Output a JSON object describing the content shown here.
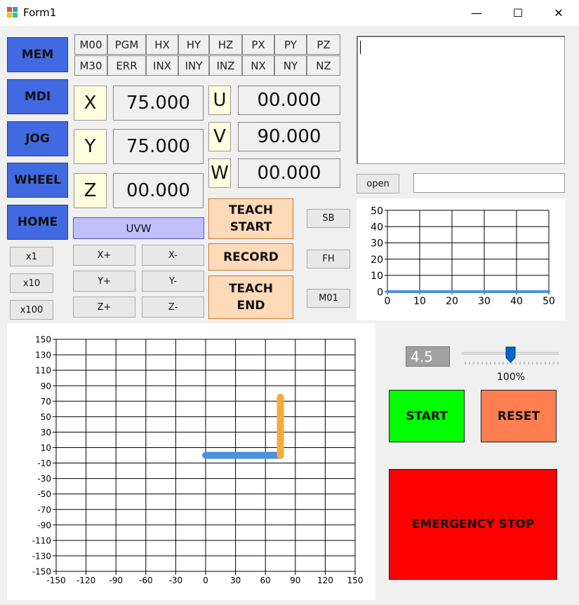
{
  "window": {
    "title": "Form1",
    "minimize": "—",
    "maximize": "☐",
    "close": "✕"
  },
  "modes": [
    "MEM",
    "MDI",
    "JOG",
    "WHEEL",
    "HOME"
  ],
  "status": {
    "row1": [
      "M00",
      "PGM",
      "HX",
      "HY",
      "HZ",
      "PX",
      "PY",
      "PZ"
    ],
    "row2": [
      "M30",
      "ERR",
      "INX",
      "INY",
      "INZ",
      "NX",
      "NY",
      "NZ"
    ]
  },
  "axes": {
    "x": {
      "label": "X",
      "value": "75.000"
    },
    "y": {
      "label": "Y",
      "value": "75.000"
    },
    "z": {
      "label": "Z",
      "value": "00.000"
    },
    "u": {
      "label": "U",
      "value": "00.000"
    },
    "v": {
      "label": "V",
      "value": "90.000"
    },
    "w": {
      "label": "W",
      "value": "00.000"
    }
  },
  "uvw_button": "UVW",
  "step": {
    "x1": "x1",
    "x10": "x10",
    "x100": "x100"
  },
  "jog": {
    "xplus": "X+",
    "xminus": "X-",
    "yplus": "Y+",
    "yminus": "Y-",
    "zplus": "Z+",
    "zminus": "Z-"
  },
  "teach": {
    "start_line1": "TEACH",
    "start_line2": "START",
    "record": "RECORD",
    "end_line1": "TEACH",
    "end_line2": "END"
  },
  "side_buttons": {
    "sb": "SB",
    "fh": "FH",
    "m01": "M01"
  },
  "file": {
    "open_label": "open",
    "path_value": "",
    "program_text": ""
  },
  "speed": {
    "value_display": "4.5",
    "slider_fraction": 0.5,
    "percent_label": "100%"
  },
  "controls": {
    "start": "START",
    "reset": "RESET",
    "emergency": "EMERGENCY STOP"
  },
  "colors": {
    "mode": "#4169e1",
    "teach": "#ffdab9",
    "start": "#00ff00",
    "reset": "#ff7f50",
    "estop": "#ff0000",
    "path_blue": "#4a90e2",
    "path_orange": "#f7a93a"
  },
  "chart_data": [
    {
      "type": "line",
      "xlim": [
        0,
        50
      ],
      "ylim": [
        0,
        50
      ],
      "xticks": [
        0,
        10,
        20,
        30,
        40,
        50
      ],
      "yticks": [
        0,
        10,
        20,
        30,
        40,
        50
      ],
      "grid": true,
      "series": [
        {
          "x": [
            0,
            50
          ],
          "y": [
            0,
            0
          ],
          "color": "#4a90e2"
        }
      ]
    },
    {
      "type": "line",
      "xlim": [
        -150,
        150
      ],
      "ylim": [
        -150,
        150
      ],
      "xticks": [
        -150,
        -120,
        -90,
        -60,
        -30,
        0,
        30,
        60,
        90,
        120,
        150
      ],
      "yticks": [
        150,
        130,
        110,
        90,
        70,
        50,
        30,
        10,
        -10,
        -30,
        -50,
        -70,
        -90,
        -110,
        -130,
        -150
      ],
      "grid": true,
      "series": [
        {
          "x": [
            0,
            75
          ],
          "y": [
            0,
            0
          ],
          "color": "#4a90e2"
        },
        {
          "x": [
            75,
            75
          ],
          "y": [
            0,
            75
          ],
          "color": "#f7a93a"
        }
      ]
    }
  ]
}
